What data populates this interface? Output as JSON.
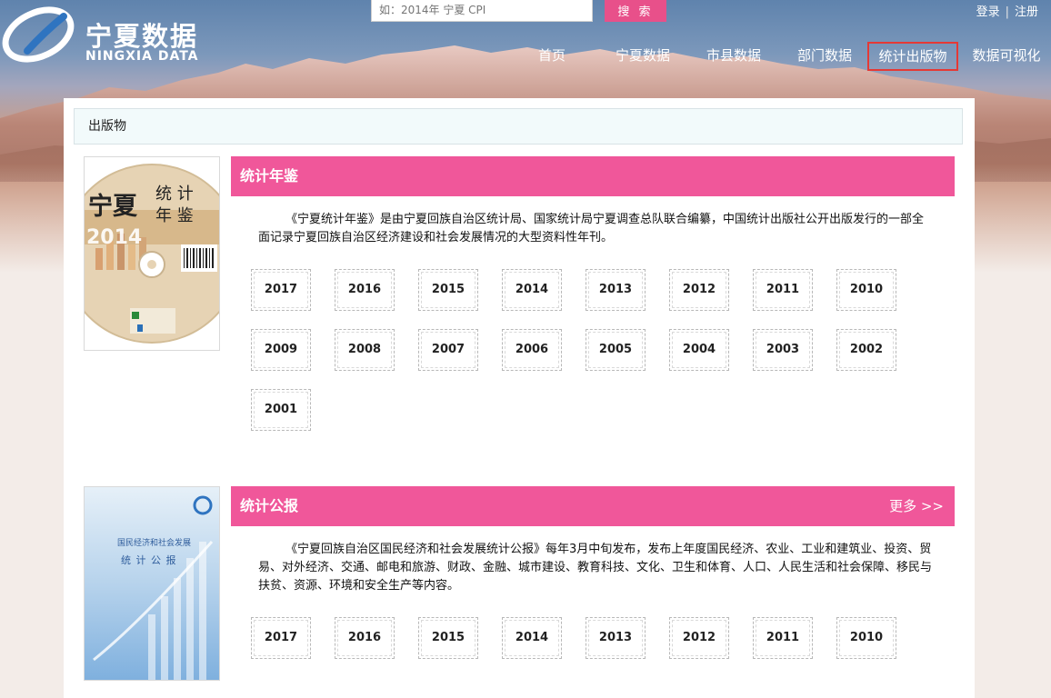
{
  "header": {
    "logo_cn": "宁夏数据",
    "logo_en": "NINGXIA DATA",
    "search": {
      "placeholder": "如：2014年 宁夏 CPI",
      "button": "搜 索"
    },
    "user_links": {
      "login": "登录",
      "separator": "|",
      "register": "注册"
    },
    "nav": [
      {
        "label": "首页"
      },
      {
        "label": "宁夏数据"
      },
      {
        "label": "市县数据"
      },
      {
        "label": "部门数据"
      },
      {
        "label": "统计出版物",
        "active": true
      },
      {
        "label": "数据可视化"
      }
    ]
  },
  "breadcrumb": "出版物",
  "sections": [
    {
      "title": "统计年鉴",
      "more": "",
      "description": "《宁夏统计年鉴》是由宁夏回族自治区统计局、国家统计局宁夏调查总队联合编纂，中国统计出版社公开出版发行的一部全面记录宁夏回族自治区经济建设和社会发展情况的大型资料性年刊。",
      "cover": {
        "title_left": "宁夏",
        "title_right_1": "统 计",
        "title_right_2": "年 鉴",
        "year": "2014"
      },
      "years": [
        "2017",
        "2016",
        "2015",
        "2014",
        "2013",
        "2012",
        "2011",
        "2010",
        "2009",
        "2008",
        "2007",
        "2006",
        "2005",
        "2004",
        "2003",
        "2002",
        "2001"
      ]
    },
    {
      "title": "统计公报",
      "more": "更多 >>",
      "description": "《宁夏回族自治区国民经济和社会发展统计公报》每年3月中旬发布，发布上年度国民经济、农业、工业和建筑业、投资、贸易、对外经济、交通、邮电和旅游、财政、金融、城市建设、教育科技、文化、卫生和体育、人口、人民生活和社会保障、移民与扶贫、资源、环境和安全生产等内容。",
      "cover": {
        "line1": "国民经济和社会发展",
        "line2": "统 计 公 报"
      },
      "years": [
        "2017",
        "2016",
        "2015",
        "2014",
        "2013",
        "2012",
        "2011",
        "2010"
      ]
    }
  ],
  "colors": {
    "accent_pink": "#f0579a",
    "search_btn": "#e8508a",
    "nav_active_border": "#e53935"
  }
}
